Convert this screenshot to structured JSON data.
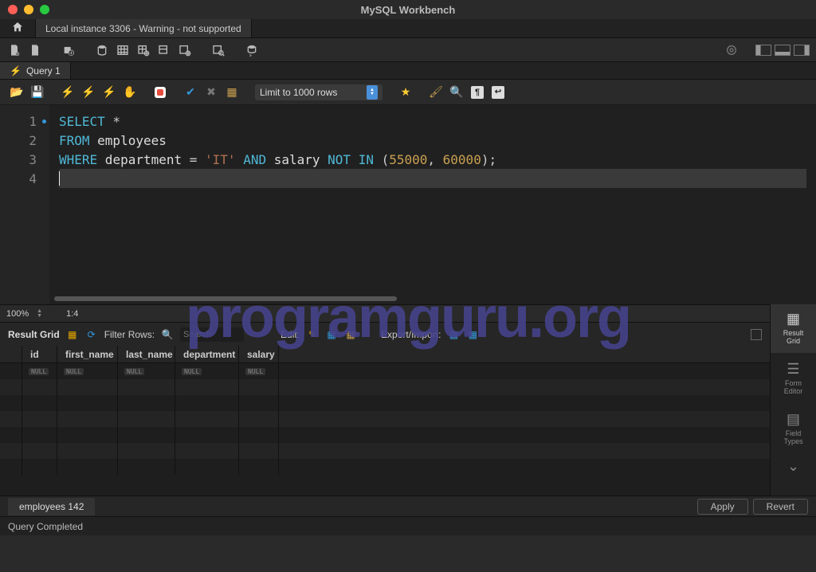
{
  "window_title": "MySQL Workbench",
  "app_tabs": {
    "connection": "Local instance 3306 - Warning - not supported"
  },
  "query_tab": {
    "label": "Query 1"
  },
  "sql_toolbar": {
    "limit": "Limit to 1000 rows"
  },
  "editor": {
    "lines": [
      "1",
      "2",
      "3",
      "4"
    ],
    "l1_kw": "SELECT",
    "l1_rest": " *",
    "l2_kw": "FROM",
    "l2_id": " employees",
    "l3_kw1": "WHERE",
    "l3_id1": " department ",
    "l3_eq": "= ",
    "l3_str": "'IT'",
    "l3_kw2": " AND",
    "l3_id2": " salary ",
    "l3_kw3": "NOT IN",
    "l3_paren": " (",
    "l3_n1": "55000",
    "l3_comma": ", ",
    "l3_n2": "60000",
    "l3_end": ");"
  },
  "zoom": {
    "pct": "100%",
    "pos": "1:4"
  },
  "result_toolbar": {
    "label": "Result Grid",
    "filter_label": "Filter Rows:",
    "search_placeholder": "Search",
    "edit_label": "Edit:",
    "export_label": "Export/Import:"
  },
  "columns": [
    "id",
    "first_name",
    "last_name",
    "department",
    "salary"
  ],
  "row_null": "NULL",
  "side": {
    "result_grid": "Result\nGrid",
    "form_editor": "Form\nEditor",
    "field_types": "Field\nTypes"
  },
  "bottom": {
    "tab": "employees 142",
    "apply": "Apply",
    "revert": "Revert"
  },
  "status": "Query Completed",
  "watermark": "programguru.org"
}
